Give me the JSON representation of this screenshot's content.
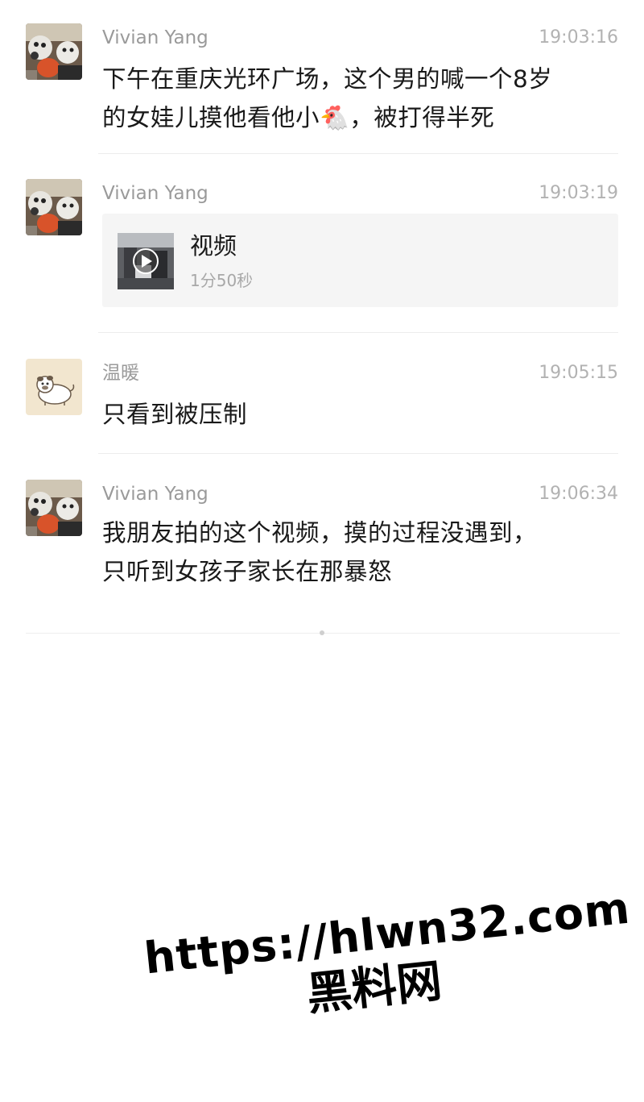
{
  "messages": [
    {
      "sender": "Vivian Yang",
      "time": "19:03:16",
      "lines": [
        "下午在重庆光环广场，这个男的喊一个8岁",
        "的女娃儿摸他看他小🐔，被打得半死"
      ]
    },
    {
      "sender": "Vivian Yang",
      "time": "19:03:19",
      "attachment": {
        "title": "视频",
        "duration": "1分50秒",
        "icon": "play-icon"
      }
    },
    {
      "sender": "温暖",
      "time": "19:05:15",
      "lines": [
        "只看到被压制"
      ]
    },
    {
      "sender": "Vivian Yang",
      "time": "19:06:34",
      "lines": [
        "我朋友拍的这个视频，摸的过程没遇到，",
        "只听到女孩子家长在那暴怒"
      ]
    }
  ],
  "watermark": {
    "url": "https://hlwn32.com",
    "site_name": "黑料网"
  },
  "colors": {
    "name_gray": "#9a9a9a",
    "time_gray": "#b2b2b2",
    "card_bg": "#f5f5f5",
    "divider": "#ececec"
  }
}
